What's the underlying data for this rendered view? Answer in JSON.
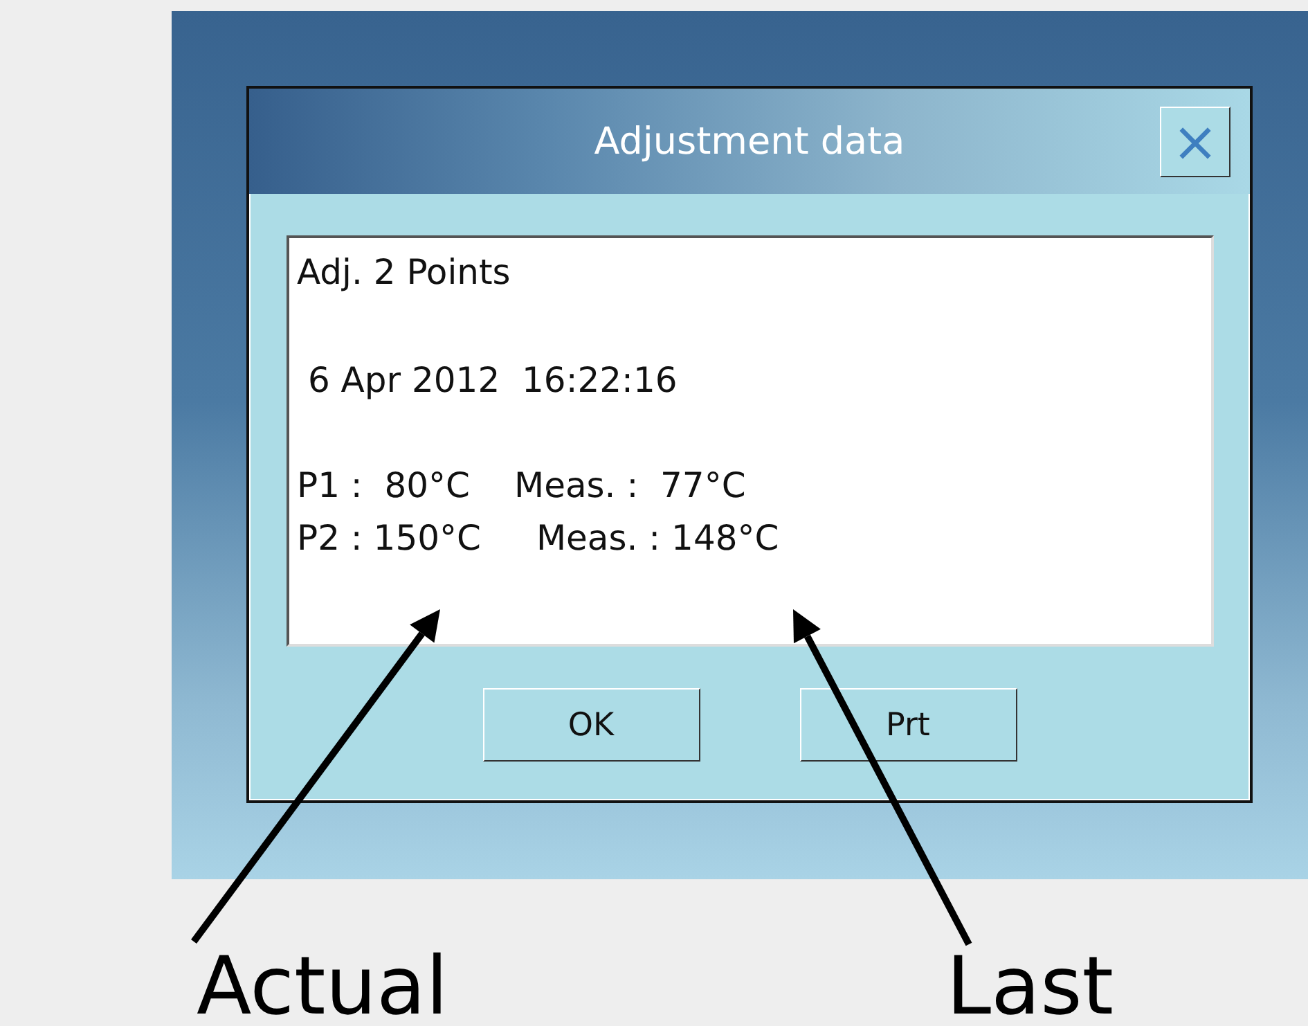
{
  "window": {
    "title": "Adjustment data",
    "close": "×"
  },
  "content": {
    "heading": "Adj. 2 Points",
    "timestamp": " 6 Apr 2012  16:22:16",
    "points": [
      {
        "setpoint": "P1 :  80°C",
        "measured": "Meas. :  77°C"
      },
      {
        "setpoint": "P2 : 150°C",
        "measured": "Meas. : 148°C"
      }
    ]
  },
  "buttons": [
    "OK",
    "Prt"
  ],
  "annotations": [
    {
      "label": "Actual"
    },
    {
      "label": "Last"
    }
  ]
}
